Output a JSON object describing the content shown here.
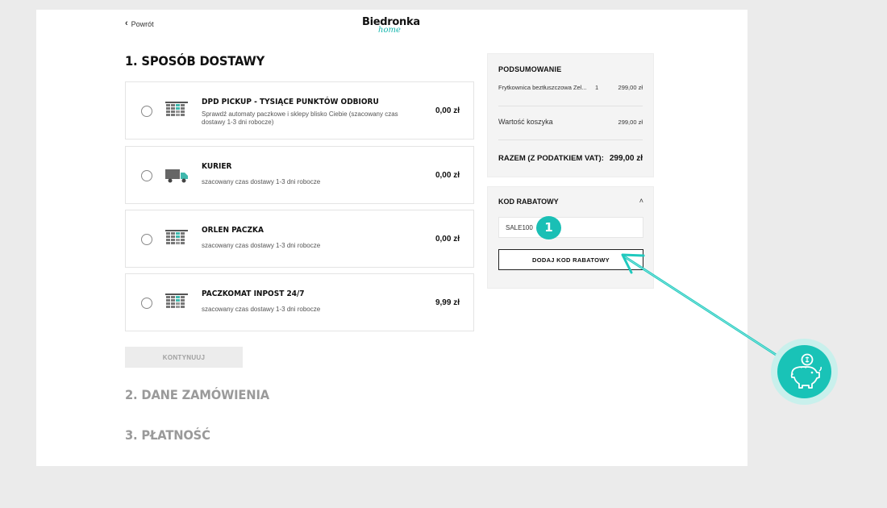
{
  "header": {
    "back_label": "Powrót",
    "logo_main": "Biedronka",
    "logo_sub": "home"
  },
  "steps": {
    "step1_title": "1. SPOSÓB DOSTAWY",
    "step2_title": "2. DANE ZAMÓWIENIA",
    "step3_title": "3. PŁATNOŚĆ"
  },
  "delivery_options": [
    {
      "title": "DPD PICKUP - TYSIĄCE PUNKTÓW ODBIORU",
      "description": "Sprawdź automaty paczkowe i sklepy blisko Ciebie (szacowany czas dostawy 1-3 dni robocze)",
      "price": "0,00 zł",
      "icon": "parcel-locker-icon"
    },
    {
      "title": "KURIER",
      "description": "szacowany czas dostawy 1-3 dni robocze",
      "price": "0,00 zł",
      "icon": "delivery-truck-icon"
    },
    {
      "title": "ORLEN PACZKA",
      "description": "szacowany czas dostawy 1-3 dni robocze",
      "price": "0,00 zł",
      "icon": "parcel-locker-icon"
    },
    {
      "title": "PACZKOMAT INPOST 24/7",
      "description": "szacowany czas dostawy 1-3 dni robocze",
      "price": "9,99 zł",
      "icon": "parcel-locker-icon"
    }
  ],
  "continue_label": "KONTYNUUJ",
  "summary": {
    "title": "PODSUMOWANIE",
    "product_name": "Frytkownica beztłuszczowa Zel...",
    "product_qty": "1",
    "product_price": "299,00 zł",
    "cart_value_label": "Wartość koszyka",
    "cart_value": "299,00 zł",
    "total_label": "RAZEM (Z PODATKIEM VAT):",
    "total_value": "299,00 zł"
  },
  "coupon": {
    "title": "KOD RABATOWY",
    "code_value": "SALE100",
    "badge": "1",
    "add_label": "DODAJ KOD RABATOWY"
  },
  "colors": {
    "accent": "#19c3b7",
    "accent_light": "#c9f0ec",
    "page_background": "#ebebeb",
    "muted_text": "#9a9a9a"
  },
  "annotation_icon": "piggy-bank-coin-icon"
}
